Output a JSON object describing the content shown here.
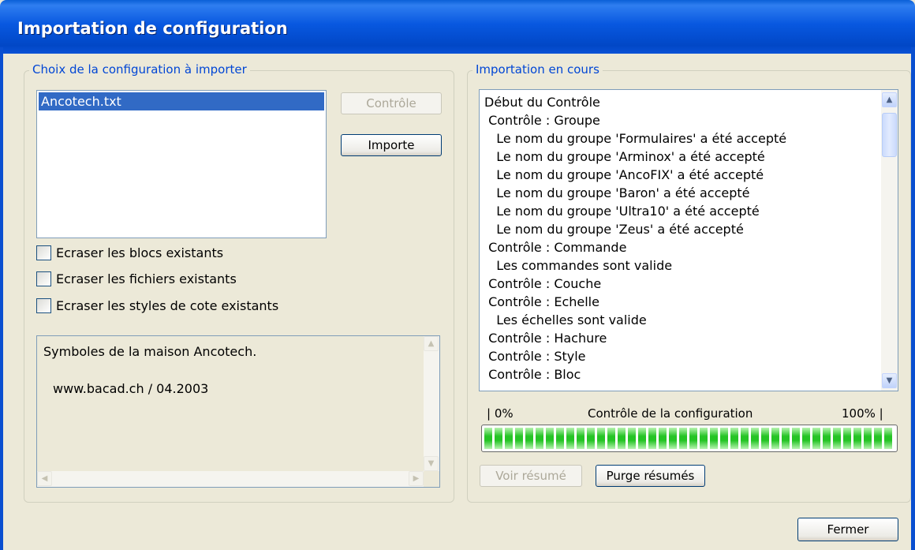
{
  "window": {
    "title": "Importation de configuration"
  },
  "left_group": {
    "legend": "Choix de la configuration à importer",
    "file_list": {
      "items": [
        "Ancotech.txt"
      ],
      "selected": "Ancotech.txt"
    },
    "control_button": "Contrôle",
    "import_button": "Importe",
    "checkboxes": [
      {
        "label": "Ecraser les blocs existants",
        "checked": false
      },
      {
        "label": "Ecraser les fichiers existants",
        "checked": false
      },
      {
        "label": "Ecraser les styles de cote existants",
        "checked": false
      }
    ],
    "description": {
      "line1": "Symboles de la maison Ancotech.",
      "line2": "www.bacad.ch / 04.2003"
    }
  },
  "right_group": {
    "legend": "Importation en cours",
    "log_lines": [
      "Début du Contrôle",
      " Contrôle : Groupe",
      "   Le nom du groupe 'Formulaires' a été accepté",
      "   Le nom du groupe 'Arminox' a été accepté",
      "   Le nom du groupe 'AncoFIX' a été accepté",
      "   Le nom du groupe 'Baron' a été accepté",
      "   Le nom du groupe 'Ultra10' a été accepté",
      "   Le nom du groupe 'Zeus' a été accepté",
      " Contrôle : Commande",
      "   Les commandes sont valide",
      " Contrôle : Couche",
      " Contrôle : Echelle",
      "   Les échelles sont valide",
      " Contrôle : Hachure",
      " Contrôle : Style",
      " Contrôle : Bloc"
    ],
    "progress": {
      "min_label": "| 0%",
      "caption": "Contrôle de la configuration",
      "max_label": "100% |",
      "value_fraction": 1.0
    },
    "view_summary_button": "Voir résumé",
    "purge_summary_button": "Purge résumés"
  },
  "close_button": "Fermer",
  "colors": {
    "accent": "#0046d5",
    "title_bar": "#0a52d6",
    "selection": "#316ac5",
    "progress": "#25c425"
  }
}
